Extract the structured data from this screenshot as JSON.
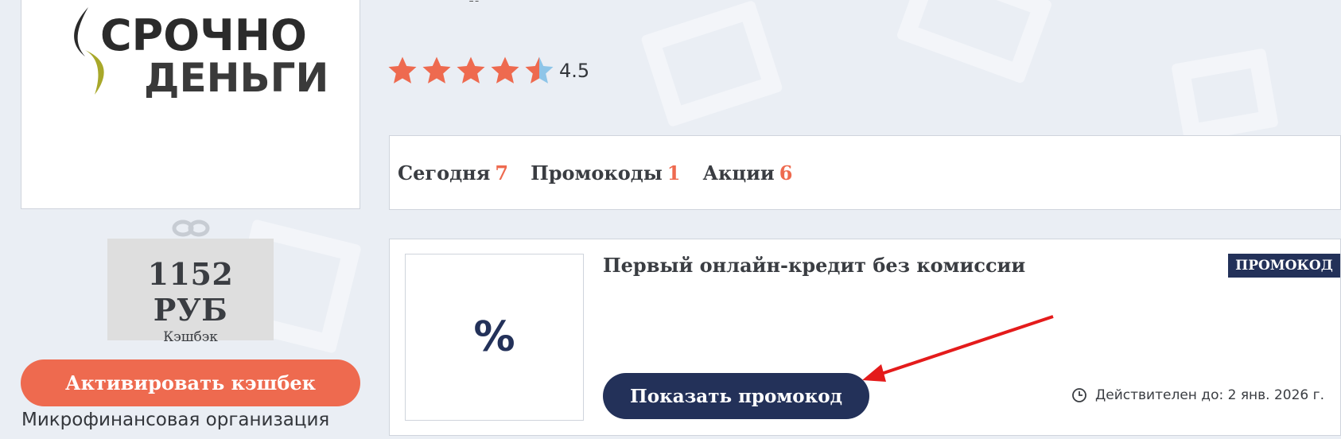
{
  "header": {
    "title_fragment": "у"
  },
  "logo": {
    "line1": "СРОЧНО",
    "line2": "ДЕНЬГИ"
  },
  "rating": {
    "value": "4.5",
    "stars": 4.5,
    "max": 5,
    "star_color": "#ee6a4f",
    "empty_color": "#8ec5e8"
  },
  "tabs": [
    {
      "label": "Сегодня",
      "count": "7"
    },
    {
      "label": "Промокоды",
      "count": "1"
    },
    {
      "label": "Акции",
      "count": "6"
    }
  ],
  "cashback": {
    "amount": "1152 РУБ",
    "label": "Кэшбэк"
  },
  "activate_button": {
    "label": "Активировать кэшбек"
  },
  "organization_type": "Микрофинансовая организация",
  "promo": {
    "thumb_symbol": "%",
    "title": "Первый онлайн-кредит без комиссии",
    "badge": "ПРОМОКОД",
    "show_button": "Показать промокод",
    "validity": "Действителен до: 2 янв. 2026 г."
  },
  "colors": {
    "accent": "#ee6a4f",
    "navy": "#233159",
    "background": "#eaeef4",
    "arrow": "#e41b1b"
  }
}
